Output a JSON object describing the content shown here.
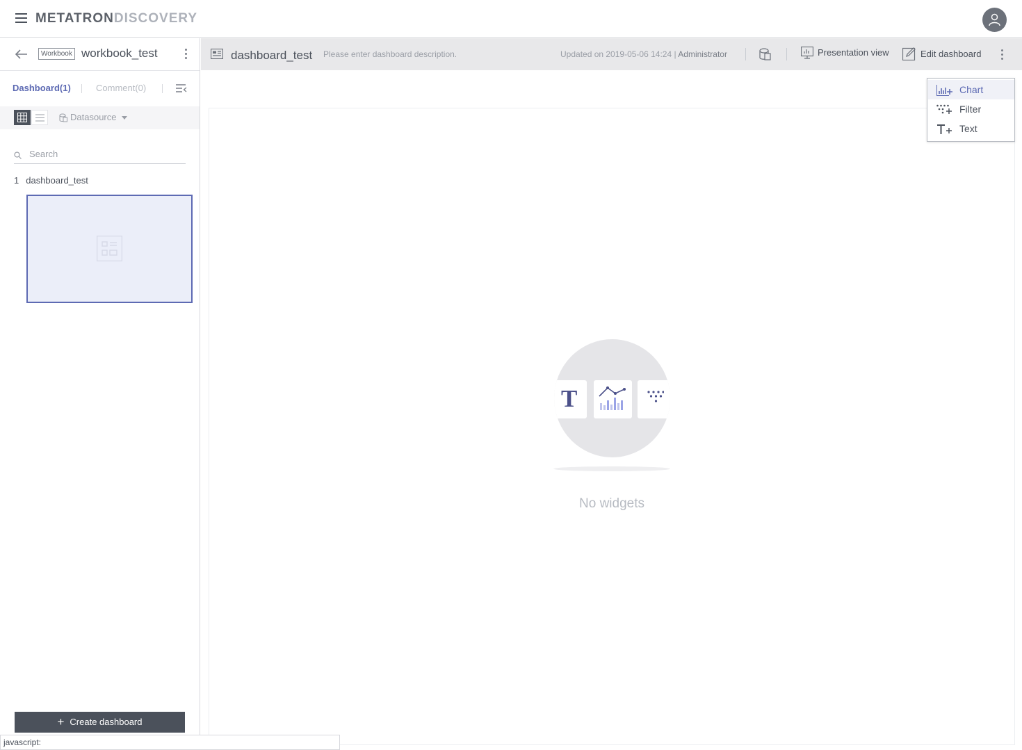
{
  "app": {
    "logo_main": "METATRON",
    "logo_sub": "DISCOVERY"
  },
  "workbook": {
    "badge": "Workbook",
    "title": "workbook_test"
  },
  "tabs": {
    "dashboard": "Dashboard(1)",
    "comment": "Comment(0)"
  },
  "toolbar": {
    "datasource_label": "Datasource"
  },
  "search": {
    "placeholder": "Search",
    "value": ""
  },
  "dashboards": [
    {
      "index": "1",
      "name": "dashboard_test"
    }
  ],
  "create_button": {
    "label": "Create dashboard"
  },
  "status_bar": {
    "text": "javascript:"
  },
  "dashboard": {
    "title": "dashboard_test",
    "description": "Please enter dashboard description.",
    "updated_prefix": "Updated on 2019-05-06 14:24 |",
    "updated_by": "Administrator",
    "presentation_label": "Presentation view",
    "edit_label": "Edit dashboard"
  },
  "empty_state": {
    "message": "No widgets",
    "text_glyph": "T"
  },
  "add_menu": {
    "items": [
      {
        "label": "Chart",
        "icon": "chart-add-icon",
        "active": true
      },
      {
        "label": "Filter",
        "icon": "filter-add-icon",
        "active": false
      },
      {
        "label": "Text",
        "icon": "text-add-icon",
        "active": false
      }
    ]
  },
  "colors": {
    "accent": "#5d6ab3",
    "dark": "#4b515b",
    "header_bg": "#e8e8ea"
  }
}
